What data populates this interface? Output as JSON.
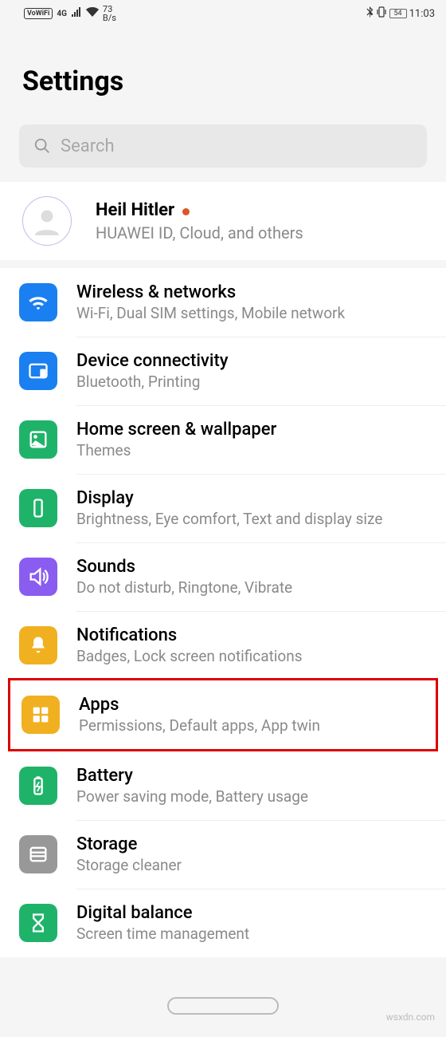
{
  "status": {
    "vowifi": "VoWiFi",
    "nettype": "4G",
    "speed_num": "73",
    "speed_unit": "B/s",
    "battery": "54",
    "time": "11:03"
  },
  "header": {
    "title": "Settings"
  },
  "search": {
    "placeholder": "Search"
  },
  "account": {
    "name": "Heil Hitler",
    "sub": "HUAWEI ID, Cloud, and others"
  },
  "items": [
    {
      "title": "Wireless & networks",
      "sub": "Wi-Fi, Dual SIM settings, Mobile network",
      "icon": "wifi",
      "color": "bg-blue"
    },
    {
      "title": "Device connectivity",
      "sub": "Bluetooth, Printing",
      "icon": "device",
      "color": "bg-blue"
    },
    {
      "title": "Home screen & wallpaper",
      "sub": "Themes",
      "icon": "home-wall",
      "color": "bg-green"
    },
    {
      "title": "Display",
      "sub": "Brightness, Eye comfort, Text and display size",
      "icon": "display",
      "color": "bg-green"
    },
    {
      "title": "Sounds",
      "sub": "Do not disturb, Ringtone, Vibrate",
      "icon": "sounds",
      "color": "bg-purple"
    },
    {
      "title": "Notifications",
      "sub": "Badges, Lock screen notifications",
      "icon": "notif",
      "color": "bg-orange"
    },
    {
      "title": "Apps",
      "sub": "Permissions, Default apps, App twin",
      "icon": "apps",
      "color": "bg-yellow",
      "highlight": true
    },
    {
      "title": "Battery",
      "sub": "Power saving mode, Battery usage",
      "icon": "battery",
      "color": "bg-green2"
    },
    {
      "title": "Storage",
      "sub": "Storage cleaner",
      "icon": "storage",
      "color": "bg-gray"
    },
    {
      "title": "Digital balance",
      "sub": "Screen time management",
      "icon": "balance",
      "color": "bg-green2"
    }
  ],
  "watermark": "wsxdn.com"
}
